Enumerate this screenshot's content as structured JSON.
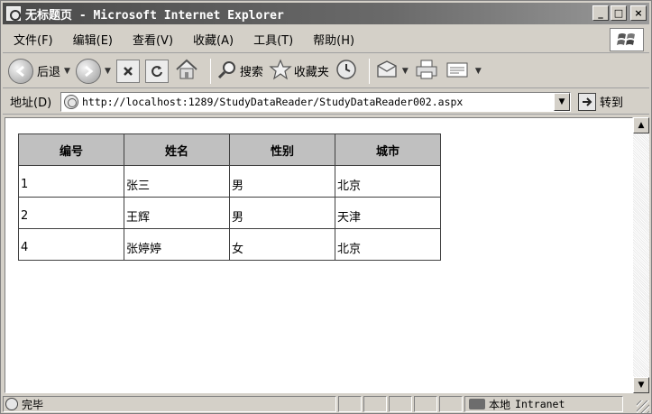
{
  "window": {
    "title": "无标题页 - Microsoft Internet Explorer",
    "controls": {
      "minimize": "_",
      "maximize": "□",
      "close": "×"
    }
  },
  "menu": {
    "items": [
      {
        "label": "文件(F)"
      },
      {
        "label": "编辑(E)"
      },
      {
        "label": "查看(V)"
      },
      {
        "label": "收藏(A)"
      },
      {
        "label": "工具(T)"
      },
      {
        "label": "帮助(H)"
      }
    ]
  },
  "toolbar": {
    "back_label": "后退",
    "search_label": "搜索",
    "favorites_label": "收藏夹"
  },
  "address": {
    "label": "地址(D)",
    "url": "http://localhost:1289/StudyDataReader/StudyDataReader002.aspx",
    "go_label": "转到"
  },
  "table": {
    "headers": [
      "编号",
      "姓名",
      "性别",
      "城市"
    ],
    "rows": [
      [
        "1",
        "张三",
        "男",
        "北京"
      ],
      [
        "2",
        "王辉",
        "男",
        "天津"
      ],
      [
        "4",
        "张婷婷",
        "女",
        "北京"
      ]
    ]
  },
  "status": {
    "text": "完毕",
    "zone_cn": "本地",
    "zone_en": "Intranet"
  },
  "icons": {
    "back": "back-arrow-icon",
    "forward": "forward-arrow-icon",
    "stop": "stop-icon",
    "refresh": "refresh-icon",
    "home": "home-icon",
    "search": "search-icon",
    "favorites": "star-icon",
    "history": "history-icon",
    "mail": "mail-icon",
    "print": "printer-icon",
    "edit": "edit-icon"
  }
}
